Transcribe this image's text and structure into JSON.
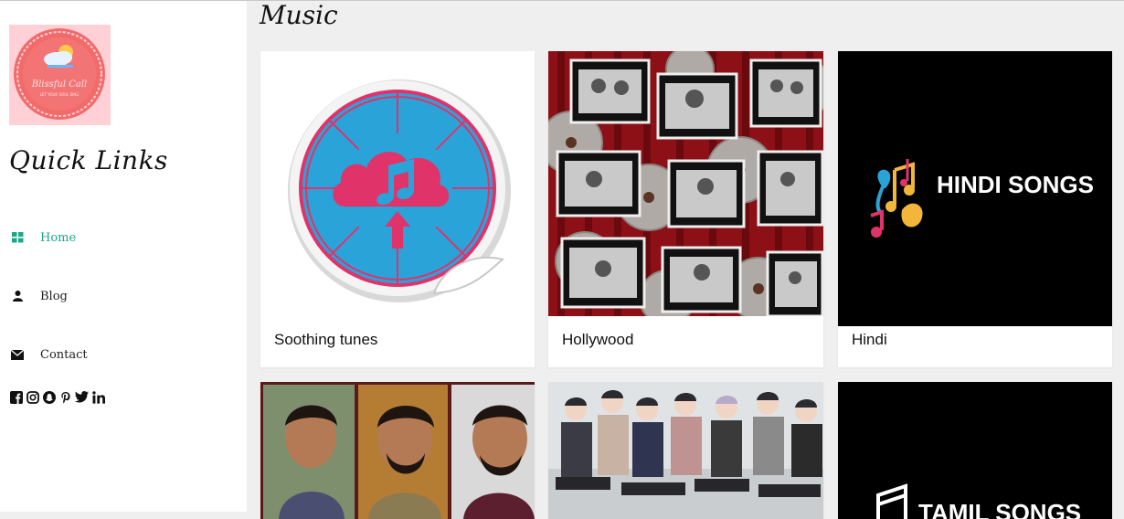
{
  "sidebar": {
    "logo": {
      "name": "Blissful Call",
      "tagline": "LET YOUR SOUL SING"
    },
    "quick_links_title": "Quick Links",
    "nav": [
      {
        "label": "Home",
        "icon": "grid-icon",
        "active": true
      },
      {
        "label": "Blog",
        "icon": "user-icon",
        "active": false
      },
      {
        "label": "Contact",
        "icon": "envelope-icon",
        "active": false
      }
    ],
    "socials": [
      "facebook-icon",
      "instagram-icon",
      "snapchat-icon",
      "pinterest-icon",
      "twitter-icon",
      "linkedin-icon"
    ]
  },
  "main": {
    "title": "Music",
    "cards": [
      {
        "label": "Soothing tunes",
        "image": "music-sticker-icon"
      },
      {
        "label": "Hollywood",
        "image": "film-reels-collage"
      },
      {
        "label": "Hindi",
        "image": "hindi-songs-banner",
        "image_text": "HINDI SONGS"
      },
      {
        "label": "",
        "image": "singers-portraits"
      },
      {
        "label": "",
        "image": "band-photo"
      },
      {
        "label": "",
        "image": "tamil-songs-banner",
        "image_text": "TAMIL SONGS"
      }
    ]
  },
  "colors": {
    "accent": "#1aa889",
    "background": "#efefef",
    "sidebar": "#ffffff",
    "logo_bg": "#ffd1d6"
  }
}
